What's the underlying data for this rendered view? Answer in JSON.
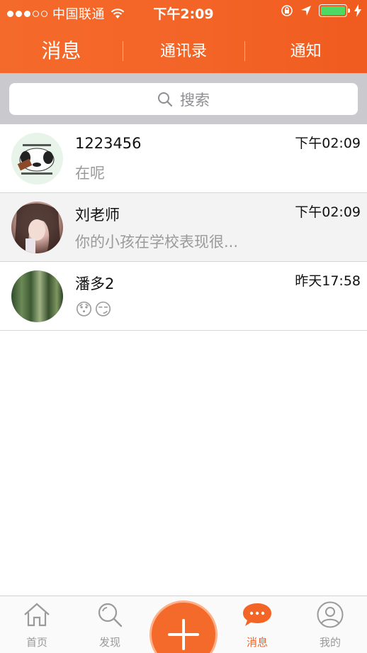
{
  "status_bar": {
    "carrier": "中国联通",
    "time": "下午2:09"
  },
  "nav": {
    "tabs": [
      {
        "label": "消息",
        "active": true
      },
      {
        "label": "通讯录",
        "active": false
      },
      {
        "label": "通知",
        "active": false
      }
    ]
  },
  "search": {
    "placeholder": "搜索",
    "icon": "search-icon"
  },
  "conversations": [
    {
      "name": "1223456",
      "preview": "在呢",
      "time": "下午02:09"
    },
    {
      "name": "刘老师",
      "preview": "你的小孩在学校表现很...",
      "time": "下午02:09"
    },
    {
      "name": "潘多2",
      "preview": "😯😏",
      "time": "昨天17:58"
    }
  ],
  "tabbar": {
    "items": [
      {
        "label": "首页",
        "icon": "home-icon"
      },
      {
        "label": "发现",
        "icon": "discover-search-icon"
      },
      {
        "label": "消息",
        "icon": "chat-bubble-icon",
        "active": true
      },
      {
        "label": "我的",
        "icon": "profile-icon"
      }
    ],
    "center_button_icon": "plus-icon"
  },
  "colors": {
    "accent": "#f36427",
    "battery": "#4cd964"
  }
}
